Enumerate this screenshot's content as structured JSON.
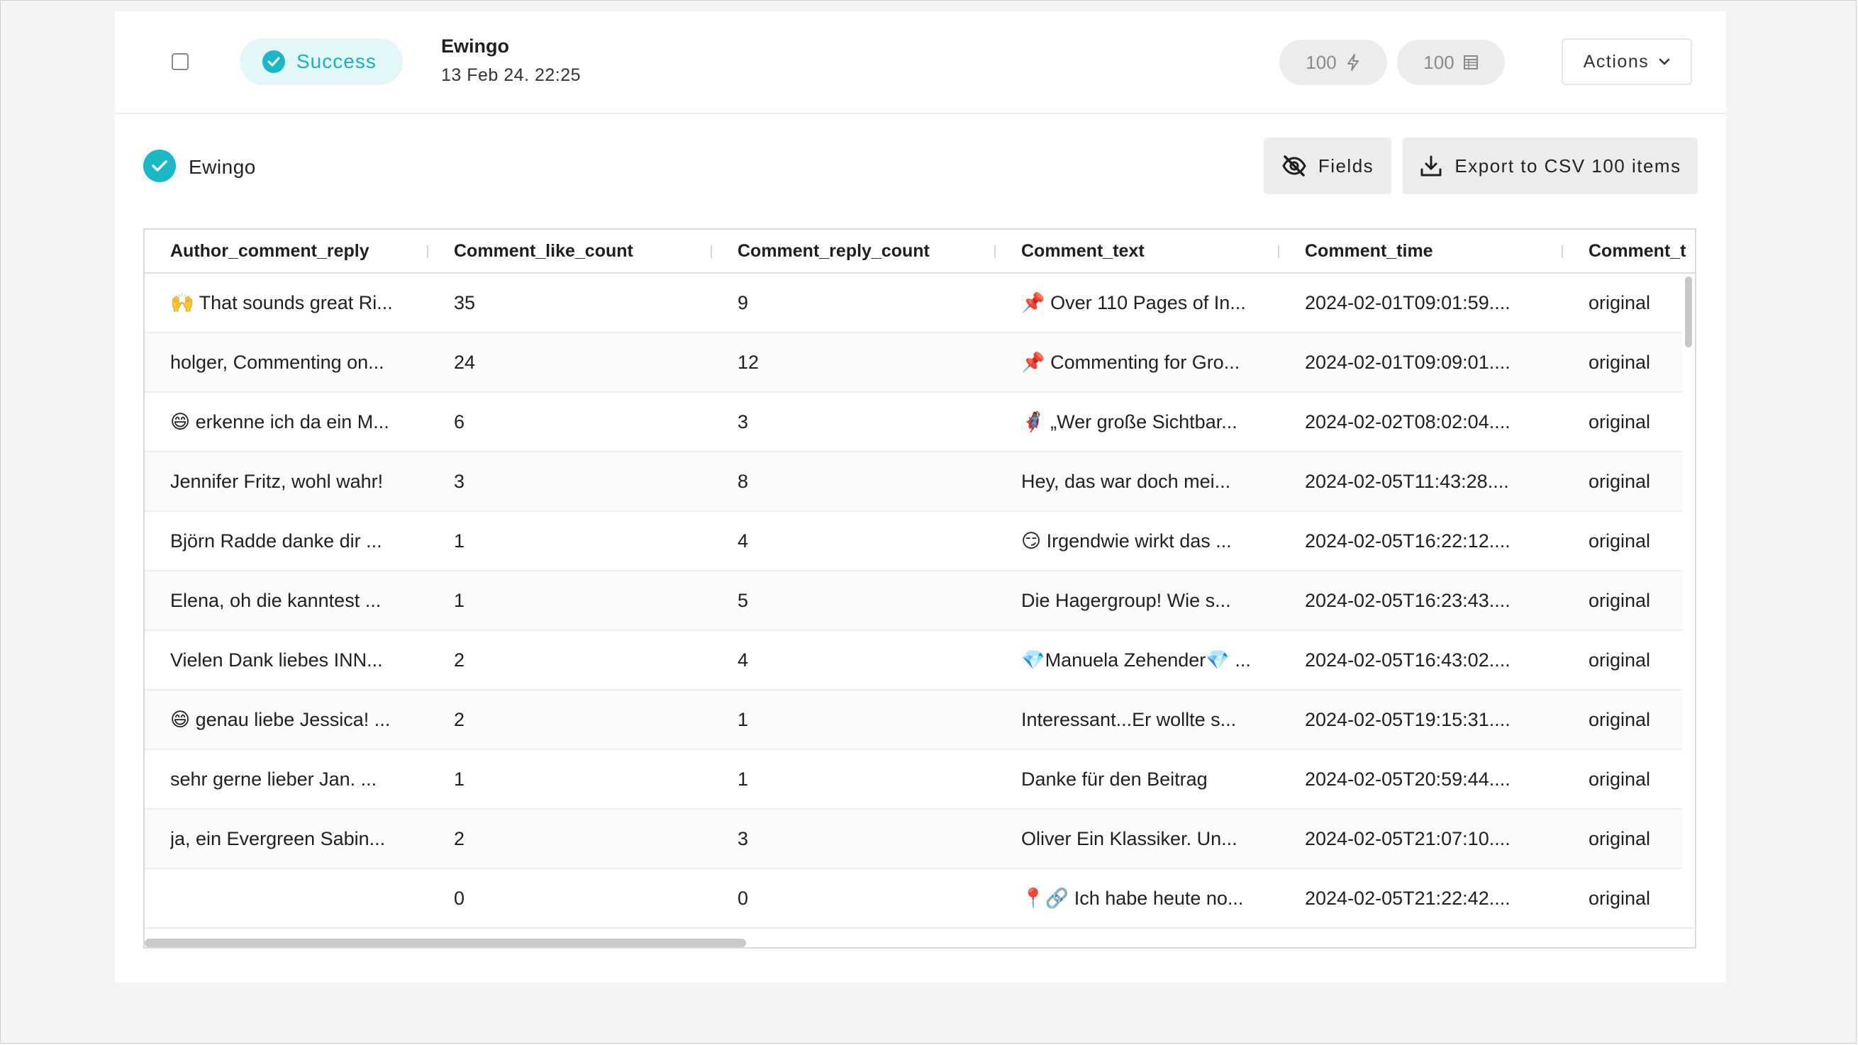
{
  "run": {
    "status": "Success",
    "name": "Ewingo",
    "date": "13 Feb 24. 22:25",
    "metric_requests": "100",
    "metric_rows": "100",
    "actions_label": "Actions"
  },
  "dataset": {
    "name": "Ewingo",
    "fields_label": "Fields",
    "export_label": "Export to CSV 100 items"
  },
  "colors": {
    "accent": "#1ab8c6",
    "success_bg": "#e3f7f9",
    "pill_bg": "#ececec"
  },
  "table": {
    "columns": [
      "Author_comment_reply",
      "Comment_like_count",
      "Comment_reply_count",
      "Comment_text",
      "Comment_time",
      "Comment_t"
    ],
    "rows": [
      [
        "🙌 That sounds great Ri...",
        "35",
        "9",
        "📌 Over 110 Pages of In...",
        "2024-02-01T09:01:59....",
        "original"
      ],
      [
        "holger, Commenting on...",
        "24",
        "12",
        "📌 Commenting for Gro...",
        "2024-02-01T09:09:01....",
        "original"
      ],
      [
        "😄 erkenne ich da ein M...",
        "6",
        "3",
        "🦸🏾‍♀️ „Wer große Sichtbar...",
        "2024-02-02T08:02:04....",
        "original"
      ],
      [
        "Jennifer Fritz, wohl wahr!",
        "3",
        "8",
        "Hey, das war doch mei...",
        "2024-02-05T11:43:28....",
        "original"
      ],
      [
        "Björn Radde danke dir ...",
        "1",
        "4",
        "😏 Irgendwie wirkt das ...",
        "2024-02-05T16:22:12....",
        "original"
      ],
      [
        "Elena, oh die kanntest ...",
        "1",
        "5",
        "Die Hagergroup! Wie s...",
        "2024-02-05T16:23:43....",
        "original"
      ],
      [
        "Vielen Dank liebes INN...",
        "2",
        "4",
        "💎Manuela Zehender💎 ...",
        "2024-02-05T16:43:02....",
        "original"
      ],
      [
        "😄 genau liebe Jessica! ...",
        "2",
        "1",
        "Interessant...Er wollte s...",
        "2024-02-05T19:15:31....",
        "original"
      ],
      [
        "sehr gerne lieber Jan. ...",
        "1",
        "1",
        "Danke für den Beitrag",
        "2024-02-05T20:59:44....",
        "original"
      ],
      [
        "ja, ein Evergreen Sabin...",
        "2",
        "3",
        "Oliver Ein Klassiker. Un...",
        "2024-02-05T21:07:10....",
        "original"
      ],
      [
        "",
        "0",
        "0",
        "📍🔗 Ich habe heute no...",
        "2024-02-05T21:22:42....",
        "original"
      ]
    ]
  }
}
